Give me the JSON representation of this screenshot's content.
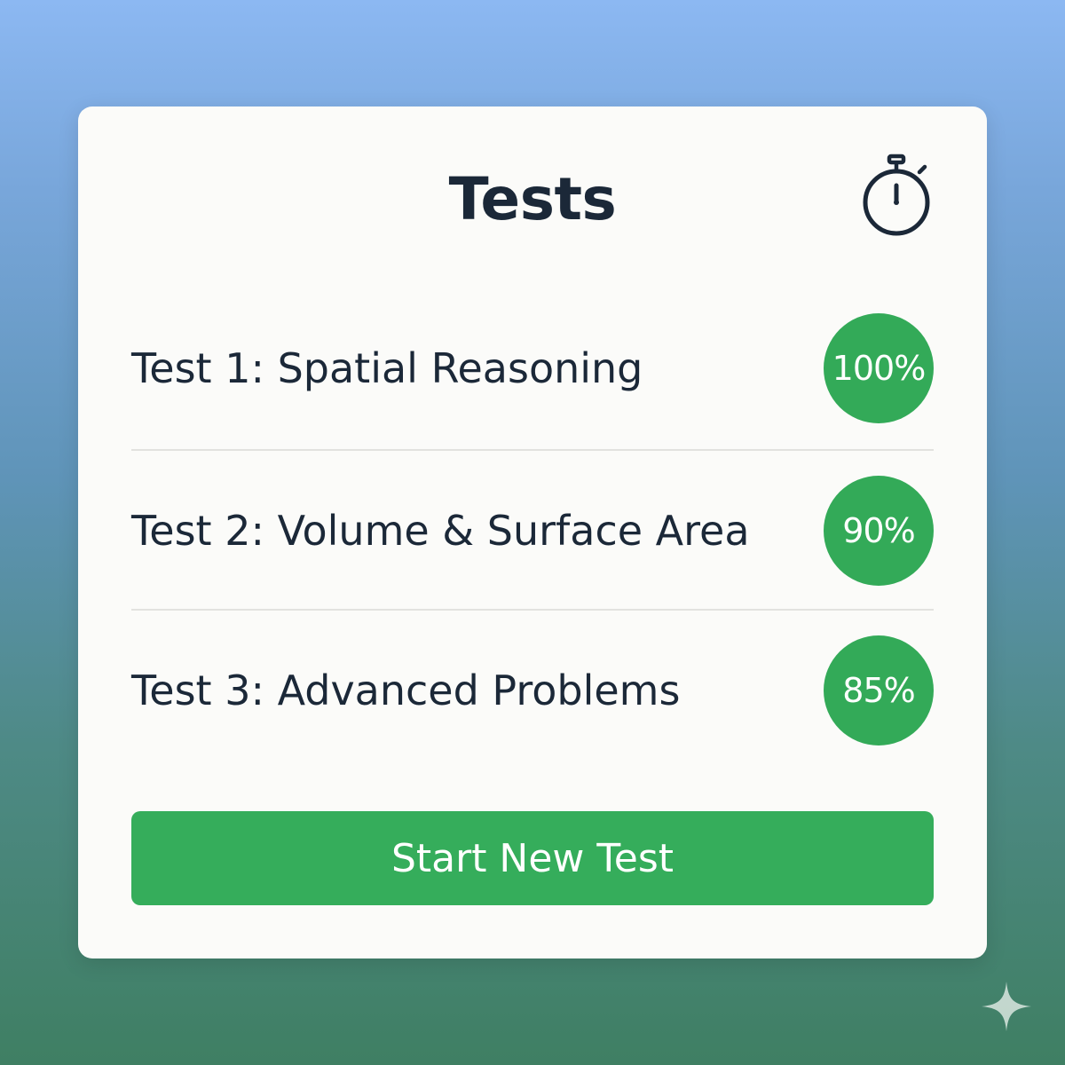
{
  "header": {
    "title": "Tests",
    "icon": "stopwatch-icon"
  },
  "tests": [
    {
      "label": "Test 1: Spatial Reasoning",
      "score": "100%"
    },
    {
      "label": "Test 2: Volume & Surface Area",
      "score": "90%"
    },
    {
      "label": "Test 3: Advanced Problems",
      "score": "85%"
    }
  ],
  "actions": {
    "start_label": "Start New Test"
  },
  "colors": {
    "accent": "#35ad5b",
    "text": "#1b2838",
    "card": "#fbfbf9"
  }
}
